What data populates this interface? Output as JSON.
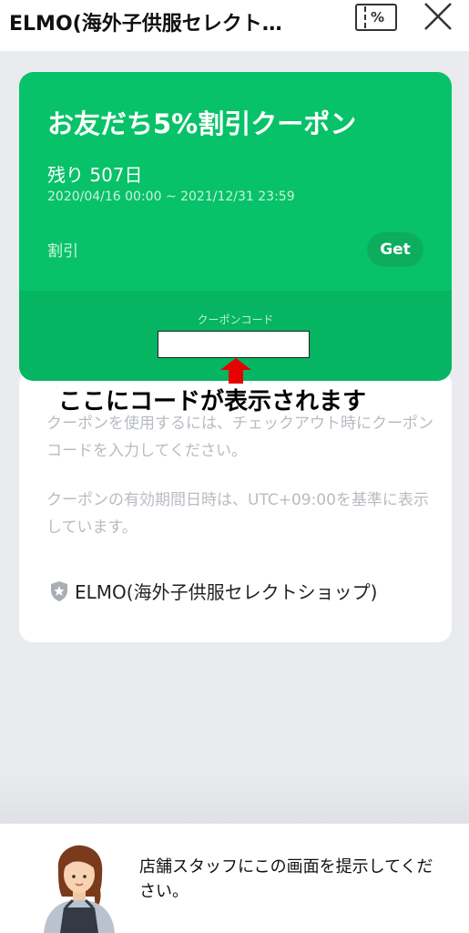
{
  "header": {
    "title": "ELMO(海外子供服セレクト…",
    "coupon_icon_text": "%",
    "coupon_icon": "coupon-ticket-icon",
    "close_icon": "close-icon"
  },
  "coupon": {
    "title": "お友だち5%割引クーポン",
    "remaining": "残り 507日",
    "period": "2020/04/16 00:00 ~ 2021/12/31 23:59",
    "type_label": "割引",
    "get_label": "Get",
    "code_label": "クーポンコード",
    "code_value": "",
    "color": "#07c268"
  },
  "annotation": {
    "text": "ここにコードが表示されます",
    "arrow_color": "#e60000"
  },
  "info": {
    "usage_note": "クーポンを使用するには、チェックアウト時にクーポンコードを入力してください。",
    "timezone_note": "クーポンの有効期間日時は、UTC+09:00を基準に表示しています。",
    "shop_icon": "shield-star-icon",
    "shop_name": "ELMO(海外子供服セレクトショップ)"
  },
  "footer": {
    "avatar": "staff-avatar",
    "message": "店舗スタッフにこの画面を提示してください。"
  }
}
